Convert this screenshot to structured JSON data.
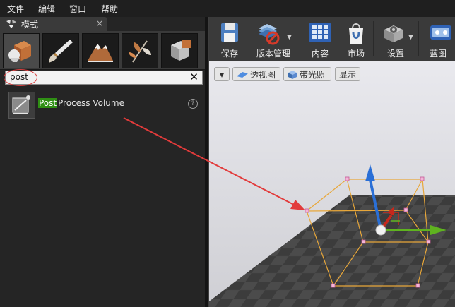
{
  "menubar": {
    "items": [
      "文件",
      "编辑",
      "窗口",
      "帮助"
    ]
  },
  "panel": {
    "tab_title": "模式",
    "tab_icon": "modes-icon",
    "close_glyph": "×",
    "mode_tabs": [
      "place-mode-icon",
      "paint-mode-icon",
      "landscape-mode-icon",
      "foliage-mode-icon",
      "geometry-mode-icon"
    ],
    "search": {
      "value": "post",
      "clear_glyph": "✕"
    },
    "results": [
      {
        "highlight": "Post",
        "rest": " Process Volume",
        "icon": "post-process-volume-icon",
        "help_glyph": "?"
      }
    ]
  },
  "toolbar": {
    "buttons": [
      {
        "label": "保存",
        "icon": "save-icon"
      },
      {
        "label": "版本管理",
        "icon": "source-control-icon"
      },
      {
        "label": "内容",
        "icon": "content-icon"
      },
      {
        "label": "市场",
        "icon": "marketplace-icon"
      },
      {
        "label": "设置",
        "icon": "settings-icon"
      },
      {
        "label": "蓝图",
        "icon": "blueprint-icon"
      }
    ]
  },
  "viewport": {
    "menu_glyph": "▾",
    "perspective_label": "透视图",
    "lit_label": "带光照",
    "show_label": "显示"
  },
  "colors": {
    "highlight_green": "#2f8f14",
    "annotation_red": "#e23b3b",
    "volume_wire": "#e8a73a",
    "gizmo_z": "#2a6fd6",
    "gizmo_y": "#5fb31f",
    "gizmo_x": "#c6281c"
  }
}
